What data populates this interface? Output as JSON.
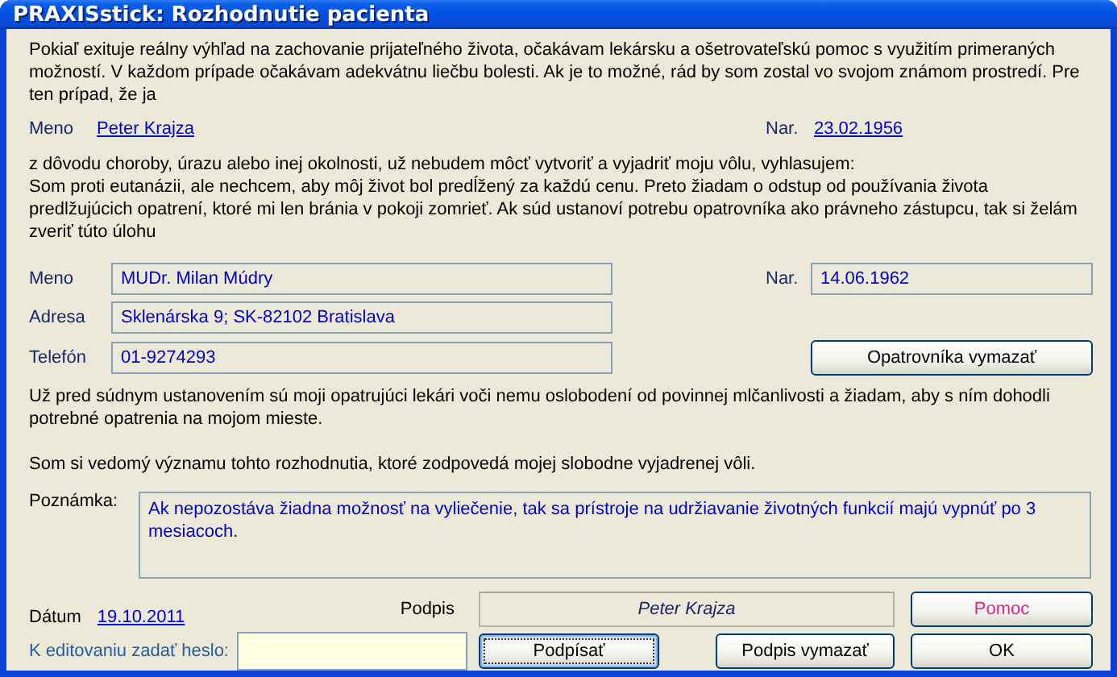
{
  "window": {
    "title": "PRAXISstick: Rozhodnutie pacienta"
  },
  "intro": "Pokiaľ exituje reálny výhľad na zachovanie prijateľného života, očakávam lekársku a ošetrovateľskú pomoc s využitím primeraných možností. V každom prípade očakávam adekvátnu liečbu bolesti. Ak je to možné, rád by som zostal vo svojom známom prostredí. Pre ten prípad, že ja",
  "patient": {
    "name_label": "Meno",
    "name": "Peter Krajza",
    "birth_label": "Nar.",
    "birth_date": "23.02.1956"
  },
  "declaration": [
    "z dôvodu choroby, úrazu alebo inej okolnosti, už nebudem môcť vytvoriť a vyjadriť moju vôlu, vyhlasujem:",
    "Som proti eutanázii, ale nechcem, aby môj život bol predĺžený za každú cenu. Preto žiadam o odstup od používania života predlžujúcich opatrení, ktoré mi len bránia v pokoji zomrieť. Ak súd ustanoví potrebu opatrovníka ako právneho zástupcu, tak si želám zveriť túto úlohu"
  ],
  "guardian": {
    "fields": [
      {
        "label": "Meno",
        "value": "MUDr. Milan Múdry"
      },
      {
        "label": "Adresa",
        "value": "Sklenárska 9; SK-82102 Bratislava"
      },
      {
        "label": "Telefón",
        "value": "01-9274293"
      }
    ],
    "birth_label": "Nar.",
    "birth_date": "14.06.1962",
    "clear_button": "Opatrovníka vymazať"
  },
  "release_text": "Už pred súdnym ustanovením sú moji opatrujúci lekári voči nemu oslobodení od povinnej mlčanlivosti a žiadam, aby s ním dohodli potrebné opatrenia na mojom mieste.",
  "awareness_text": "Som si vedomý významu tohto rozhodnutia, ktoré zodpovedá mojej slobodne vyjadrenej vôli.",
  "note": {
    "label": "Poznámka:",
    "value": "Ak nepozostáva žiadna možnosť na vyliečenie, tak sa prístroje na udržiavanie životných funkcií majú vypnúť po 3 mesiacoch."
  },
  "date": {
    "label": "Dátum",
    "value": "19.10.2011"
  },
  "signature": {
    "label": "Podpis",
    "value": "Peter Krajza"
  },
  "password": {
    "label": "K editovaniu zadať heslo:"
  },
  "buttons": [
    {
      "label": "Pomoc",
      "kind": "help"
    },
    {
      "label": "Podpísať",
      "kind": "focused"
    },
    {
      "label": "Podpis vymazať",
      "kind": "normal"
    },
    {
      "label": "OK",
      "kind": "normal"
    }
  ]
}
